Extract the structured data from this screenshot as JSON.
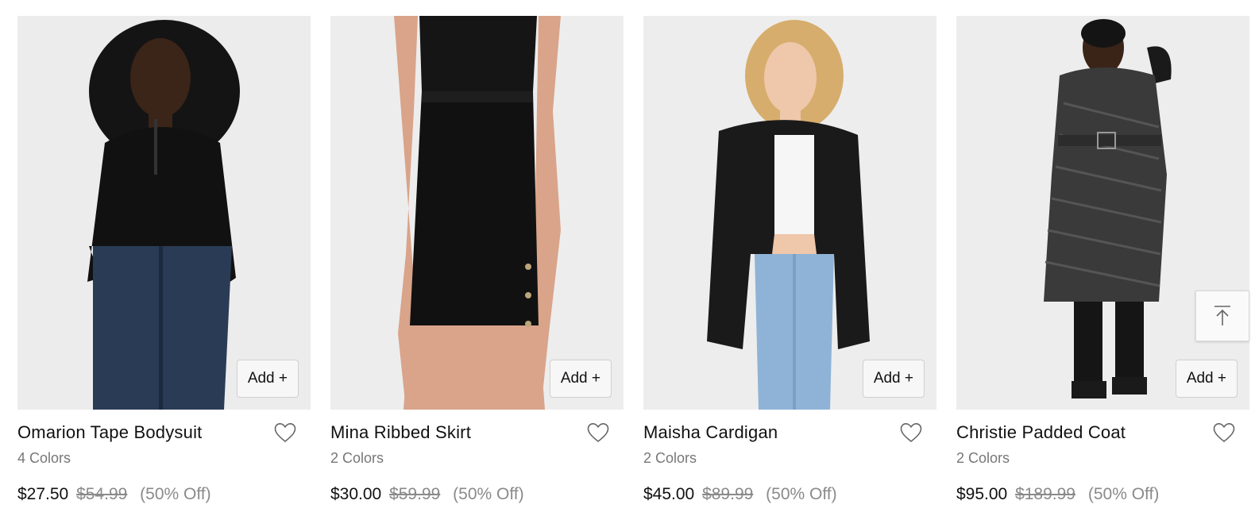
{
  "products": [
    {
      "name": "Omarion Tape Bodysuit",
      "colors": "4 Colors",
      "price": "$27.50",
      "original_price": "$54.99",
      "discount": "(50% Off)",
      "add_label": "Add +"
    },
    {
      "name": "Mina Ribbed Skirt",
      "colors": "2 Colors",
      "price": "$30.00",
      "original_price": "$59.99",
      "discount": "(50% Off)",
      "add_label": "Add +"
    },
    {
      "name": "Maisha Cardigan",
      "colors": "2 Colors",
      "price": "$45.00",
      "original_price": "$89.99",
      "discount": "(50% Off)",
      "add_label": "Add +"
    },
    {
      "name": "Christie Padded Coat",
      "colors": "2 Colors",
      "price": "$95.00",
      "original_price": "$189.99",
      "discount": "(50% Off)",
      "add_label": "Add +"
    }
  ],
  "icons": {
    "wishlist": "heart-outline-icon",
    "back_to_top": "arrow-up-to-top-icon"
  },
  "colors": {
    "image_bg": "#ebebeb",
    "text": "#111111",
    "muted": "#8a8a8a"
  }
}
